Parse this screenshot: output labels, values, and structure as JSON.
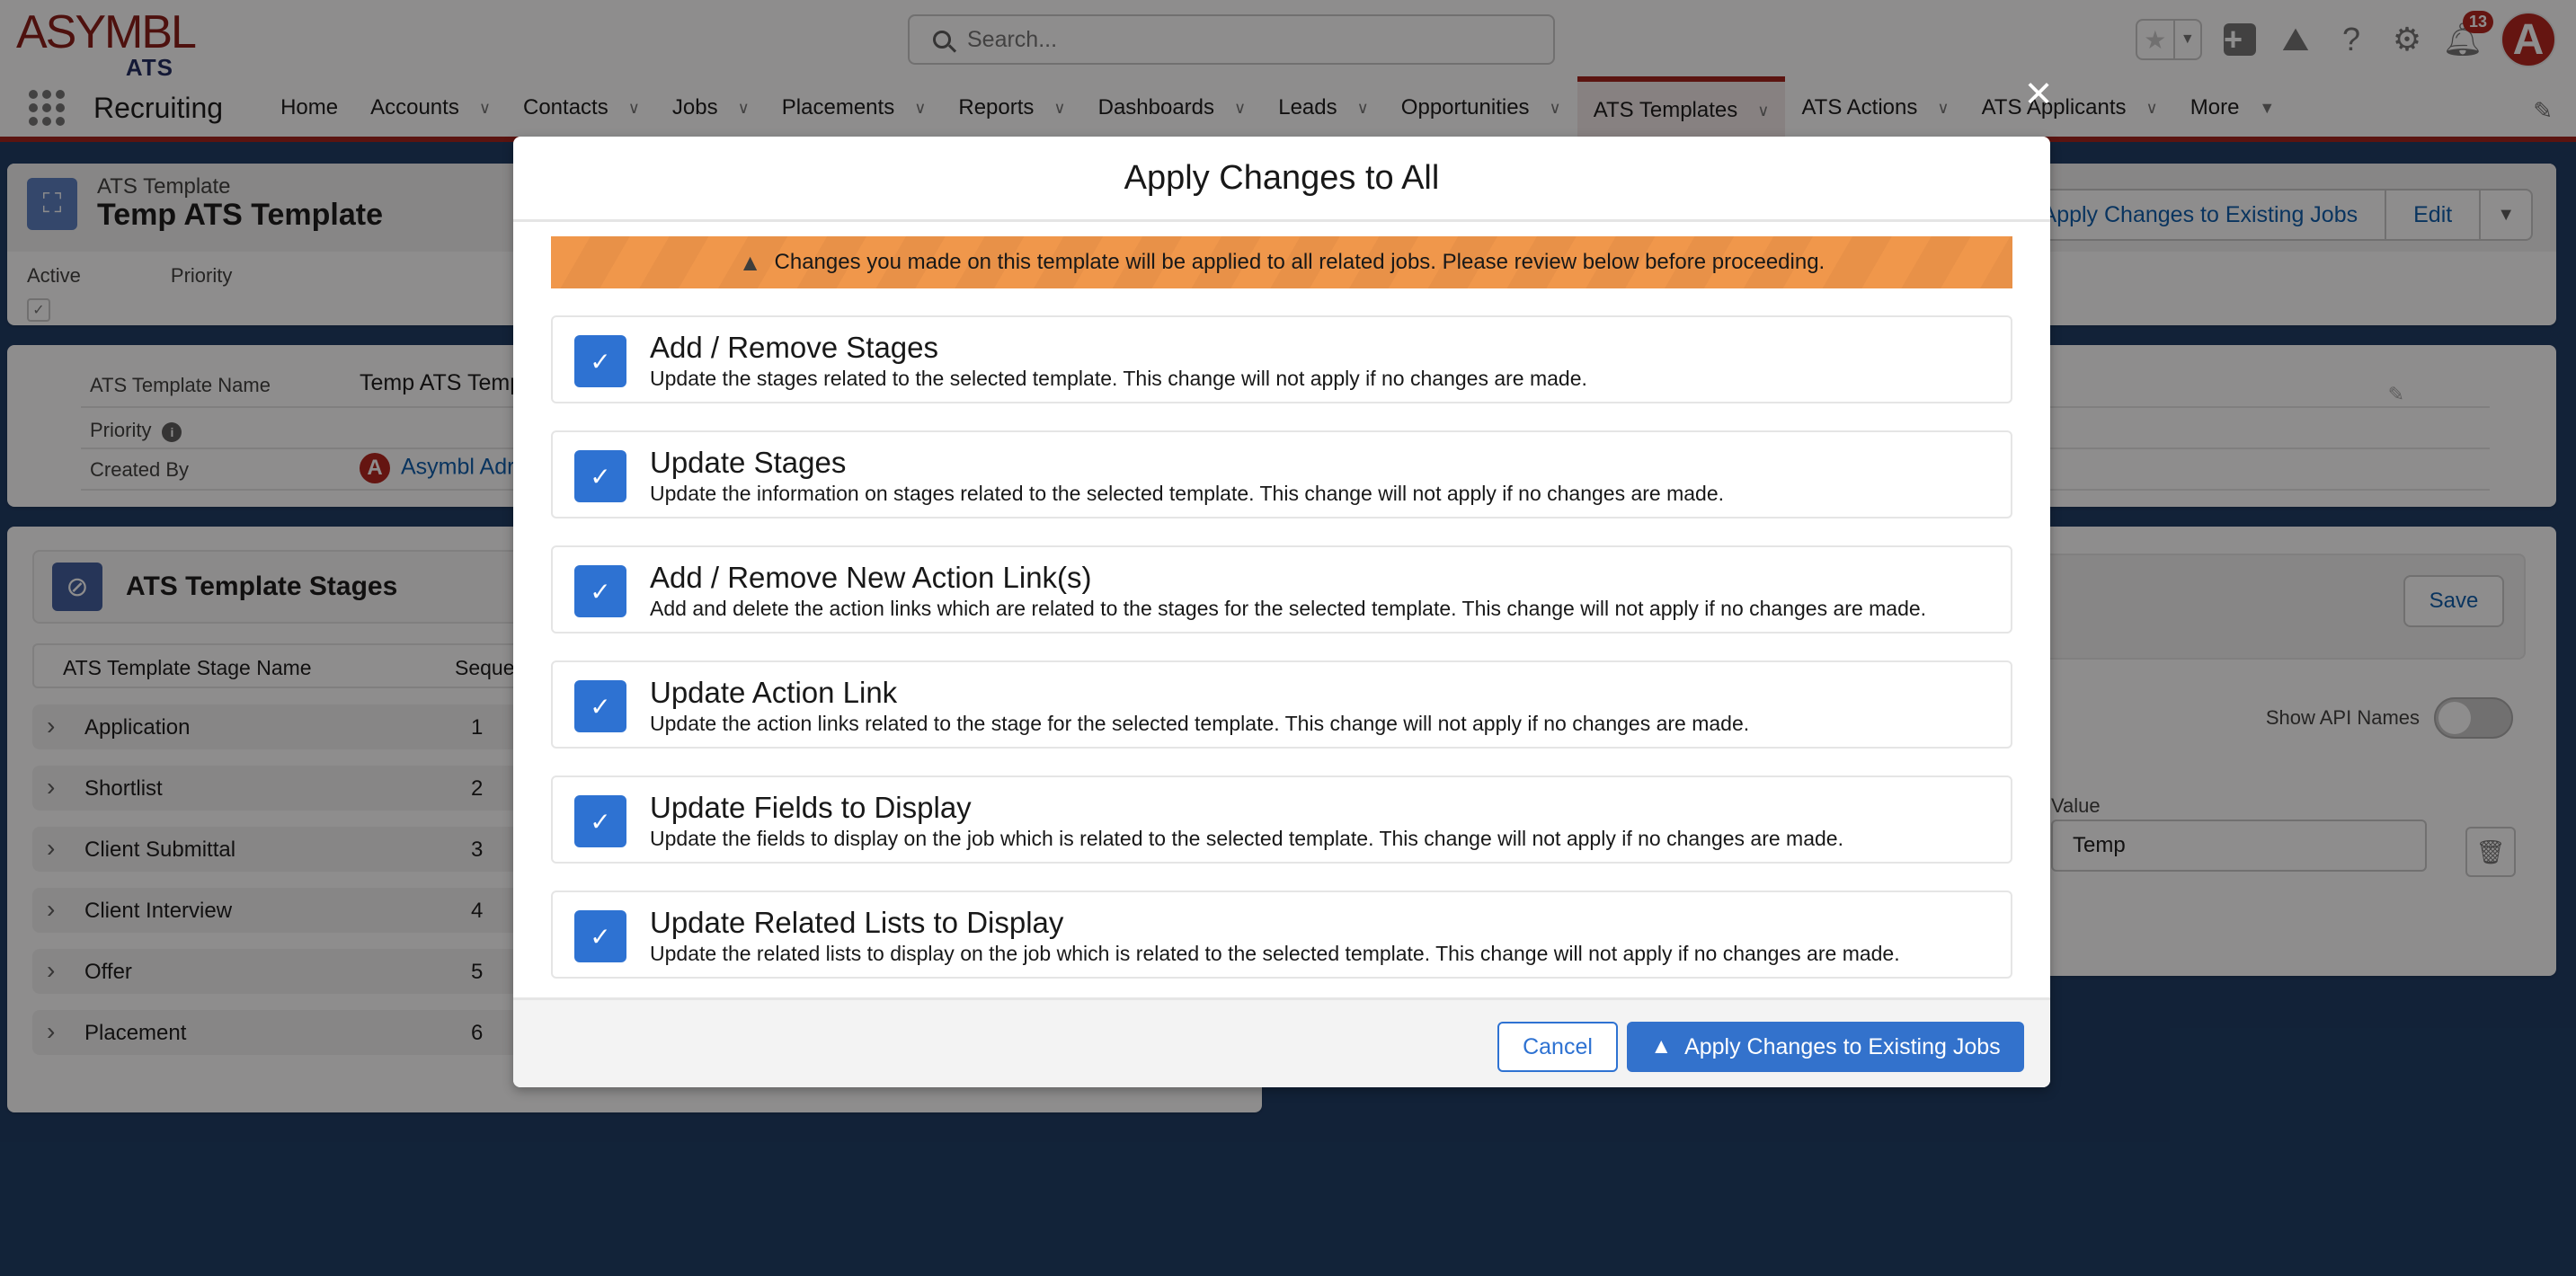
{
  "header": {
    "logo_main": "ASYMBL",
    "logo_sub": "ATS",
    "search_placeholder": "Search...",
    "notification_count": "13",
    "avatar_initial": "A"
  },
  "nav": {
    "app_name": "Recruiting",
    "items": [
      {
        "label": "Home",
        "has_menu": false
      },
      {
        "label": "Accounts",
        "has_menu": true
      },
      {
        "label": "Contacts",
        "has_menu": true
      },
      {
        "label": "Jobs",
        "has_menu": true
      },
      {
        "label": "Placements",
        "has_menu": true
      },
      {
        "label": "Reports",
        "has_menu": true
      },
      {
        "label": "Dashboards",
        "has_menu": true
      },
      {
        "label": "Leads",
        "has_menu": true
      },
      {
        "label": "Opportunities",
        "has_menu": true
      },
      {
        "label": "ATS Templates",
        "has_menu": true,
        "active": true
      },
      {
        "label": "ATS Actions",
        "has_menu": true
      },
      {
        "label": "ATS Applicants",
        "has_menu": true
      }
    ],
    "more_label": "More"
  },
  "record": {
    "type": "ATS Template",
    "title": "Temp ATS Template",
    "highlights": {
      "active_label": "Active",
      "active_checked": true,
      "priority_label": "Priority"
    },
    "actions": {
      "apply": "Apply Changes to Existing Jobs",
      "edit": "Edit"
    }
  },
  "details": {
    "name_label": "ATS Template Name",
    "name_value": "Temp ATS Temp",
    "priority_label": "Priority",
    "created_by_label": "Created By",
    "created_by_value": "Asymbl Adr"
  },
  "stages": {
    "title": "ATS Template Stages",
    "columns": [
      "ATS Template Stage Name",
      "Seque"
    ],
    "rows": [
      {
        "name": "Application",
        "sequence": "1"
      },
      {
        "name": "Shortlist",
        "sequence": "2"
      },
      {
        "name": "Client Submittal",
        "sequence": "3"
      },
      {
        "name": "Client Interview",
        "sequence": "4"
      },
      {
        "name": "Offer",
        "sequence": "5"
      },
      {
        "name": "Placement",
        "sequence": "6"
      }
    ]
  },
  "right_panel": {
    "save_label": "Save",
    "show_api_label": "Show API Names",
    "show_api_on": false,
    "value_label": "Value",
    "value_input": "Temp"
  },
  "modal": {
    "title": "Apply Changes to All",
    "warning": "Changes you made on this template will be applied to all related jobs. Please review below before proceeding.",
    "options": [
      {
        "title": "Add / Remove Stages",
        "desc": "Update the stages related to the selected template. This change will not apply if no changes are made.",
        "checked": true
      },
      {
        "title": "Update Stages",
        "desc": "Update the information on stages related to the selected template. This change will not apply if no changes are made.",
        "checked": true
      },
      {
        "title": "Add / Remove New Action Link(s)",
        "desc": "Add and delete the action links which are related to the stages for the selected template. This change will not apply if no changes are made.",
        "checked": true
      },
      {
        "title": "Update Action Link",
        "desc": "Update the action links related to the stage for the selected template. This change will not apply if no changes are made.",
        "checked": true
      },
      {
        "title": "Update Fields to Display",
        "desc": "Update the fields to display on the job which is related to the selected template. This change will not apply if no changes are made.",
        "checked": true
      },
      {
        "title": "Update Related Lists to Display",
        "desc": "Update the related lists to display on the job which is related to the selected template. This change will not apply if no changes are made.",
        "checked": true
      }
    ],
    "cancel_label": "Cancel",
    "apply_label": "Apply Changes to Existing Jobs"
  },
  "colors": {
    "brand_red": "#a12119",
    "primary_blue": "#2e72d2",
    "warning_orange": "#f0974b"
  }
}
